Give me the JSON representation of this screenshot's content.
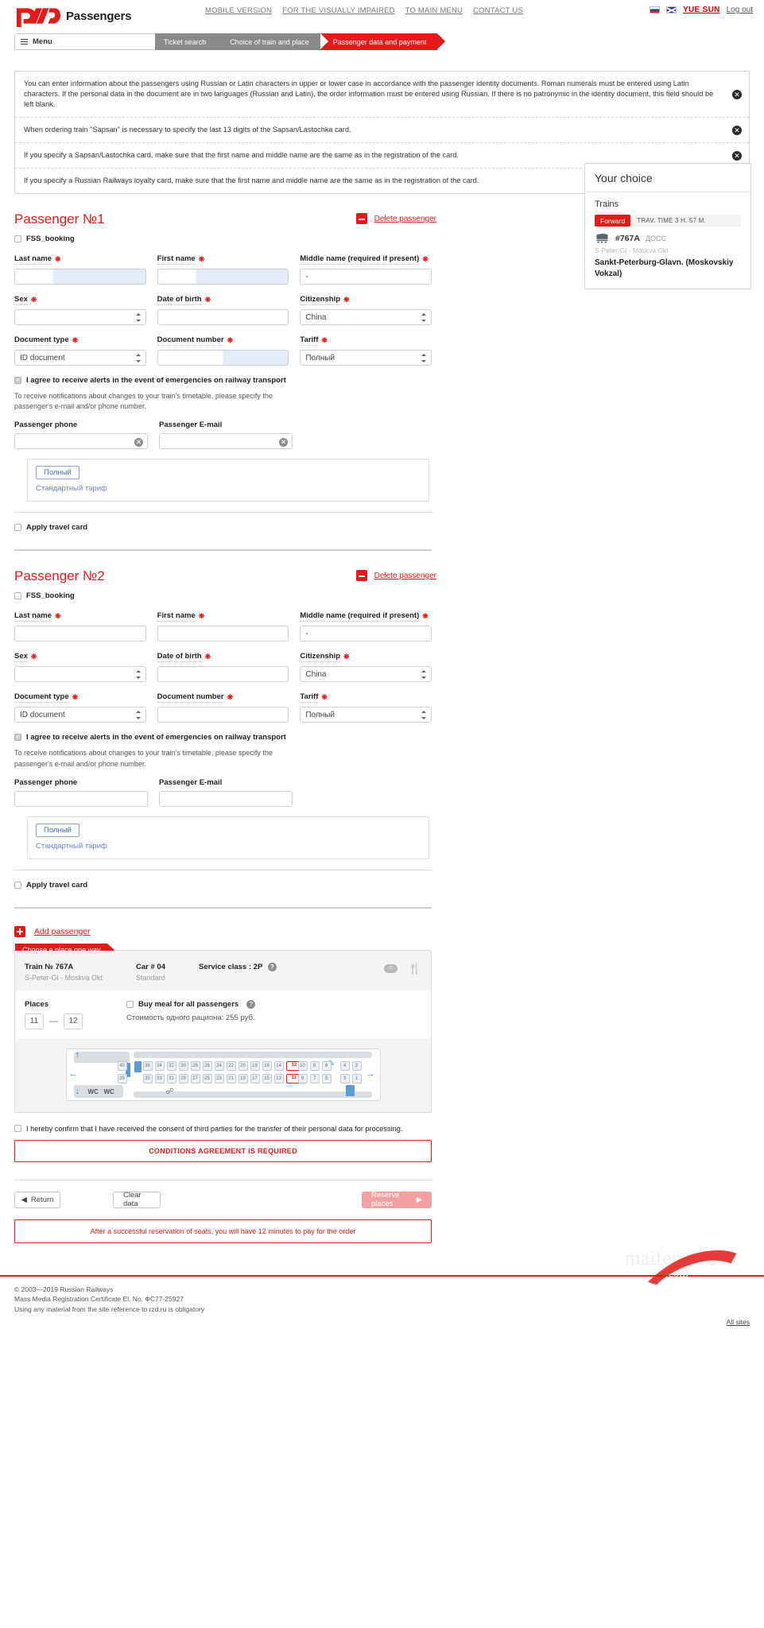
{
  "header": {
    "logo_text": "Passengers",
    "top_links": [
      "MOBILE VERSION",
      "FOR THE VISUALLY IMPAIRED",
      "TO MAIN MENU",
      "CONTACT US"
    ],
    "user_name": "YUE SUN",
    "logout": "Log out",
    "flags": [
      "ru-flag-icon",
      "en-flag-icon"
    ]
  },
  "nav": {
    "menu_label": "Menu",
    "steps": [
      {
        "label": "Ticket search",
        "active": false
      },
      {
        "label": "Choice of train and place",
        "active": false
      },
      {
        "label": "Passenger data and payment",
        "active": true
      }
    ]
  },
  "notices": [
    "You can enter information about the passengers using Russian or Latin characters in upper or lower case in accordance with the passenger identity documents. Roman numerals must be entered using Latin characters. If the personal data in the document are in two languages (Russian and Latin), the order information must be entered using Russian. If there is no patronymic in the identity document, this field should be left blank.",
    "When ordering train \"Sapsan\" is necessary to specify the last 13 digits of the Sapsan/Lastochka card.",
    "If you specify a Sapsan/Lastochka card, make sure that the first name and middle name are the same as in the registration of the card.",
    "If you specify a Russian Railways loyalty card, make sure that the first name and middle name are the same as in the registration of the card."
  ],
  "notice_close_label": "✕",
  "passengers": [
    {
      "title": "Passenger №1",
      "delete_label": "Delete passenger",
      "fss_label": "FSS_booking",
      "fss_checked": false,
      "fields": {
        "last_name_label": "Last name",
        "last_name_value": "",
        "first_name_label": "First name",
        "first_name_value": "",
        "middle_name_label": "Middle name (required if present)",
        "middle_name_value": "-",
        "sex_label": "Sex",
        "sex_value": "",
        "dob_label": "Date of birth",
        "dob_value": "",
        "citizenship_label": "Citizenship",
        "citizenship_value": "China",
        "doc_type_label": "Document type",
        "doc_type_value": "ID document",
        "doc_number_label": "Document number",
        "doc_number_value": "",
        "tariff_label": "Tariff",
        "tariff_value": "Полный"
      },
      "alerts_label": "I agree to receive alerts in the event of emergencies on railway transport",
      "alerts_checked": true,
      "hint": "To receive notifications about changes to your train's timetable, please specify the passenger's e-mail and/or phone number.",
      "phone_label": "Passenger phone",
      "phone_value": "",
      "email_label": "Passenger E-mail",
      "email_value": "",
      "has_clear_icons": true,
      "tariff_chip": "Полный",
      "tariff_sub": "Стандартный тариф",
      "travel_card_label": "Apply travel card",
      "travel_card_checked": false
    },
    {
      "title": "Passenger №2",
      "delete_label": "Delete passenger",
      "fss_label": "FSS_booking",
      "fss_checked": false,
      "fields": {
        "last_name_label": "Last name",
        "last_name_value": "",
        "first_name_label": "First name",
        "first_name_value": "",
        "middle_name_label": "Middle name (required if present)",
        "middle_name_value": "-",
        "sex_label": "Sex",
        "sex_value": "",
        "dob_label": "Date of birth",
        "dob_value": "",
        "citizenship_label": "Citizenship",
        "citizenship_value": "China",
        "doc_type_label": "Document type",
        "doc_type_value": "ID document",
        "doc_number_label": "Document number",
        "doc_number_value": "",
        "tariff_label": "Tariff",
        "tariff_value": "Полный"
      },
      "alerts_label": "I agree to receive alerts in the event of emergencies on railway transport",
      "alerts_checked": true,
      "hint": "To receive notifications about changes to your train's timetable, please specify the passenger's e-mail and/or phone number.",
      "phone_label": "Passenger phone",
      "phone_value": "",
      "email_label": "Passenger E-mail",
      "email_value": "",
      "has_clear_icons": false,
      "tariff_chip": "Полный",
      "tariff_sub": "Стандартный тариф",
      "travel_card_label": "Apply travel card",
      "travel_card_checked": false
    }
  ],
  "add_passenger_label": "Add passenger",
  "car_panel": {
    "ribbon": "Choose a place one way",
    "train_label": "Train №  767A",
    "train_route": "S-Peter-Gl - Moskva Okt",
    "car_label": "Car # 04",
    "car_class": "Standard",
    "service_class": "Service class : 2P",
    "places_label": "Places",
    "place_from": "11",
    "place_to": "12",
    "places_dash": "—",
    "meal_label": "Buy meal for all passengers",
    "meal_checked": false,
    "meal_price": "Стоимость одного рациона: 255 руб.",
    "selected_seats": [
      "11",
      "12"
    ],
    "seat_numbers_top": [
      "36",
      "34",
      "32",
      "30",
      "28",
      "26",
      "24",
      "22",
      "20",
      "18",
      "16",
      "14",
      "12",
      "10",
      "8",
      "6",
      "4",
      "2"
    ],
    "seat_numbers_bottom": [
      "35",
      "33",
      "31",
      "29",
      "27",
      "25",
      "23",
      "21",
      "19",
      "17",
      "15",
      "13",
      "11",
      "9",
      "7",
      "5",
      "3",
      "1"
    ],
    "wc_label": "WC"
  },
  "confirm": {
    "consent_label": "I hereby confirm that I have received the consent of third parties for the transfer of their personal data for processing.",
    "consent_checked": false,
    "warning": "CONDITIONS AGREEMENT IS REQUIRED"
  },
  "buttons": {
    "return": "Return",
    "clear": "Clear data",
    "reserve": "Reserve places"
  },
  "timer_note": "After a successful reservation of seats, you will have 12 minutes to pay for the order",
  "sidepanel": {
    "title": "Your choice",
    "trains_label": "Trains",
    "direction_badge": "Forward",
    "travel_time": "TRAV. TIME 3 H. 57 M.",
    "train_number": "#767A",
    "train_brand": "ДОСС",
    "route_short": "S-Peter-Gl - Moskva Okt",
    "station": "Sankt-Peterburg-Glavn. (Moskovskiy Vokzal)"
  },
  "footer": {
    "line1": "© 2003—2019  Russian Railways",
    "line2": "Mass Media Registration Certificate El. No. ФС77-25927",
    "line3": "Using any material from the site reference to rzd.ru is obligatory",
    "all_sites": "All sites",
    "watermark": "maifengwe",
    "watermark2": ".com"
  },
  "colors": {
    "brand_red": "#e21a1a",
    "step_gray": "#8a8a8a",
    "autofill_blue": "#e4ebf8"
  }
}
